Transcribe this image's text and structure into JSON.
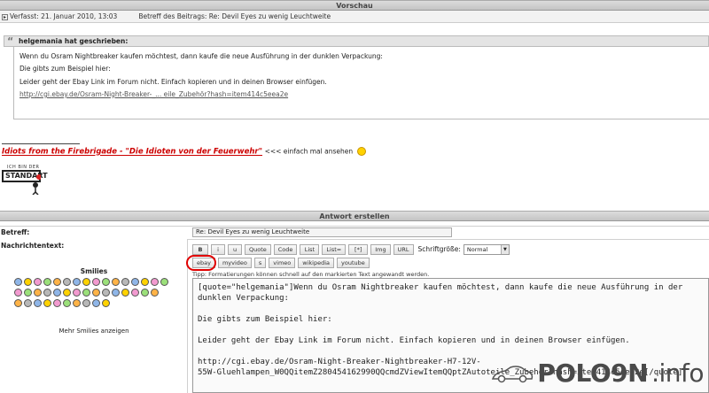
{
  "preview": {
    "title": "Vorschau",
    "posted_label": "Verfasst: 21. Januar 2010, 13:03",
    "subject_label": "Betreff des Beitrags: Re: Devil Eyes zu wenig Leuchtweite",
    "quote_author": "helgemania hat geschrieben:",
    "quote_lines": [
      "Wenn du Osram Nightbreaker kaufen möchtest, dann kaufe die neue Ausführung in der dunklen Verpackung:",
      "Die gibts zum Beispiel hier:",
      "Leider geht der Ebay Link im Forum nicht. Einfach kopieren und in deinen Browser einfügen."
    ],
    "quote_link": "http://cgi.ebay.de/Osram-Night-Breaker-_... eile_Zubehör?hash=item414c5eea2e",
    "signature_link": "Idiots from the Firebrigade - \"Die Idioten von der Feuerwehr\"",
    "signature_rest": "<<< einfach mal ansehen",
    "badge_small": "ICH BIN DER",
    "badge_text": "STANDART"
  },
  "form": {
    "title": "Antwort erstellen",
    "subject_label": "Betreff:",
    "subject_value": "Re: Devil Eyes zu wenig Leuchtweite",
    "message_label": "Nachrichtentext:",
    "smilies_title": "Smilies",
    "more_smilies": "Mehr Smilies anzeigen",
    "toolbar_row1": [
      "B",
      "i",
      "u",
      "Quote",
      "Code",
      "List",
      "List=",
      "[*]",
      "Img",
      "URL"
    ],
    "font_size_label": "Schriftgröße:",
    "font_size_value": "Normal",
    "toolbar_row2": [
      "ebay",
      "myvideo",
      "s",
      "vimeo",
      "wikipedia",
      "youtube"
    ],
    "tip": "Tipp: Formatierungen können schnell auf den markierten Text angewandt werden.",
    "message_value": "[quote=\"helgemania\"]Wenn du Osram Nightbreaker kaufen möchtest, dann kaufe die neue Ausführung in der dunklen Verpackung:\n\nDie gibts zum Beispiel hier:\n\nLeider geht der Ebay Link im Forum nicht. Einfach kopieren und in deinen Browser einfügen.\n\nhttp://cgi.ebay.de/Osram-Night-Breaker-Nightbreaker-H7-12V-\n55W-Gluehlampen_W0QQitemZ280454162990QQcmdZViewItemQQptZAutoteile_Zubehör?hash=item414c5eea2e[/quote]"
  },
  "watermark": {
    "brand": "POLO9N",
    "tld": ".info"
  },
  "colors": {
    "highlight": "#e00000",
    "signature": "#cc0000"
  }
}
